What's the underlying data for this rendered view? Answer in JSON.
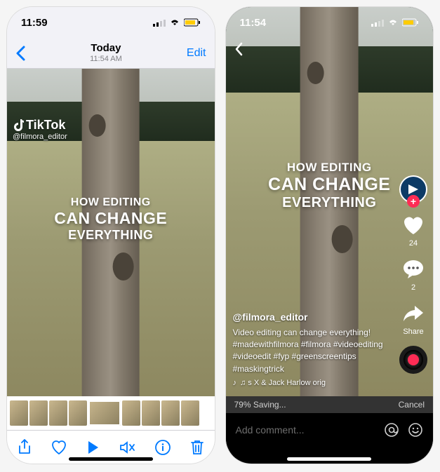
{
  "left": {
    "status_time": "11:59",
    "nav_title": "Today",
    "nav_subtitle": "11:54 AM",
    "edit_label": "Edit",
    "watermark_brand": "TikTok",
    "watermark_handle": "@filmora_editor",
    "overlay": {
      "l1": "HOW EDITING",
      "l2": "CAN CHANGE",
      "l3": "EVERYTHING"
    }
  },
  "right": {
    "status_time": "11:54",
    "overlay": {
      "l1": "HOW EDITING",
      "l2": "CAN CHANGE",
      "l3": "EVERYTHING"
    },
    "rail": {
      "like_count": "24",
      "comment_count": "2",
      "share_label": "Share"
    },
    "meta": {
      "username": "@filmora_editor",
      "caption": "Video editing can change everything!",
      "hashtags": "#madewithfilmora #filmora #videoediting #videoedit #fyp #greenscreentips #maskingtrick",
      "music": "♫  s X & Jack Harlow   orig"
    },
    "progress": {
      "percent": "79%",
      "status": "Saving...",
      "cancel": "Cancel"
    },
    "comment_placeholder": "Add comment..."
  }
}
